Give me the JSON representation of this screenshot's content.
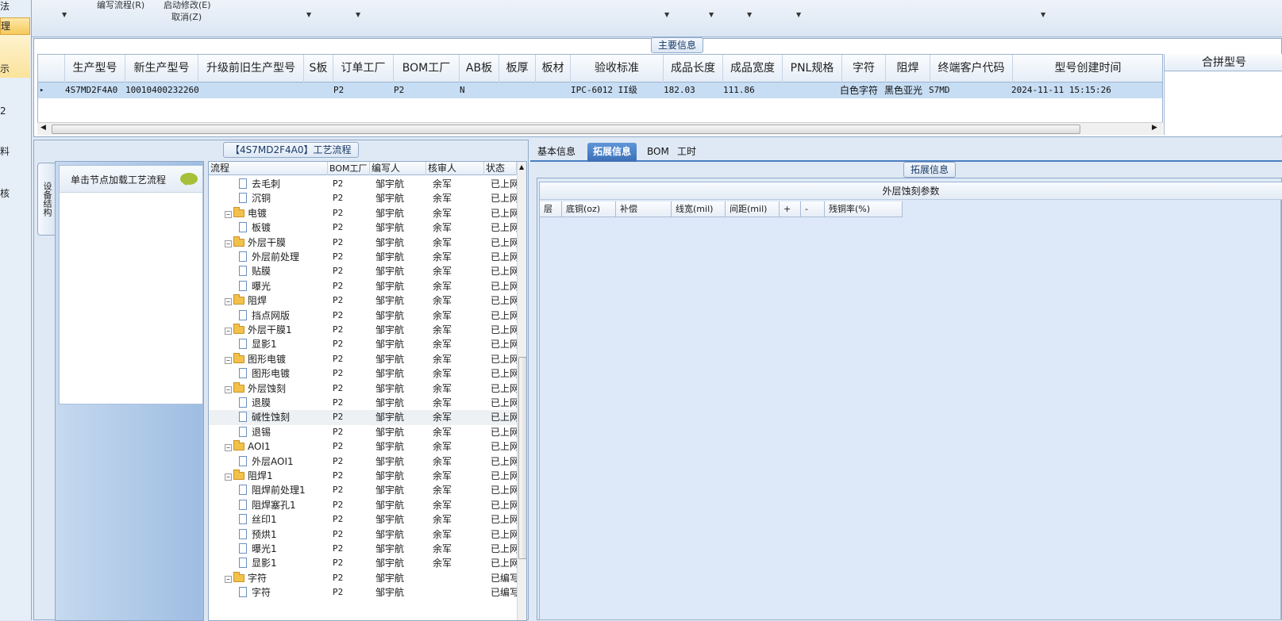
{
  "left_nav": {
    "items": [
      {
        "label": "法"
      },
      {
        "label": "理"
      },
      {
        "label": "示"
      },
      {
        "label": "2"
      },
      {
        "label": "料"
      },
      {
        "label": "核"
      }
    ]
  },
  "toolbar": {
    "edit_flow": "编写流程(R)",
    "start_modify": "启动修改(E)",
    "cancel": "取消(Z)"
  },
  "main_info": {
    "title": "主要信息",
    "columns": [
      "生产型号",
      "新生产型号",
      "升级前旧生产型号",
      "S板",
      "订单工厂",
      "BOM工厂",
      "AB板",
      "板厚",
      "板材",
      "验收标准",
      "成品长度",
      "成品宽度",
      "PNL规格",
      "字符",
      "阻焊",
      "终端客户代码",
      "型号创建时间"
    ],
    "row": {
      "indicator": "▸",
      "生产型号": "4S7MD2F4A0",
      "新生产型号": "10010400232260",
      "升级前旧生产型号": "",
      "S板": "",
      "订单工厂": "P2",
      "BOM工厂": "P2",
      "AB板": "N",
      "板厚": "",
      "板材": "",
      "验收标准": "IPC-6012 II级",
      "成品长度": "182.03",
      "成品宽度": "111.86",
      "PNL规格": "",
      "字符": "白色字符",
      "阻焊": "黑色亚光",
      "终端客户代码": "S7MD",
      "型号创建时间": "2024-11-11 15:15:26"
    },
    "right_header": "合拼型号"
  },
  "process": {
    "title": "【4S7MD2F4A0】工艺流程",
    "vertical_tab": "设备结构",
    "node_hint": "单击节点加载工艺流程",
    "columns": [
      "流程",
      "BOM工厂",
      "编写人",
      "核审人",
      "状态"
    ],
    "rows": [
      {
        "name": "去毛刺",
        "type": "doc",
        "level": 2,
        "bom": "P2",
        "writer": "邹宇航",
        "reviewer": "余军",
        "status": "已上网"
      },
      {
        "name": "沉铜",
        "type": "doc",
        "level": 2,
        "bom": "P2",
        "writer": "邹宇航",
        "reviewer": "余军",
        "status": "已上网"
      },
      {
        "name": "电镀",
        "type": "folder",
        "level": 1,
        "bom": "P2",
        "writer": "邹宇航",
        "reviewer": "余军",
        "status": "已上网"
      },
      {
        "name": "板镀",
        "type": "doc",
        "level": 2,
        "bom": "P2",
        "writer": "邹宇航",
        "reviewer": "余军",
        "status": "已上网"
      },
      {
        "name": "外层干膜",
        "type": "folder",
        "level": 1,
        "bom": "P2",
        "writer": "邹宇航",
        "reviewer": "余军",
        "status": "已上网"
      },
      {
        "name": "外层前处理",
        "type": "doc",
        "level": 2,
        "bom": "P2",
        "writer": "邹宇航",
        "reviewer": "余军",
        "status": "已上网"
      },
      {
        "name": "贴膜",
        "type": "doc",
        "level": 2,
        "bom": "P2",
        "writer": "邹宇航",
        "reviewer": "余军",
        "status": "已上网"
      },
      {
        "name": "曝光",
        "type": "doc",
        "level": 2,
        "bom": "P2",
        "writer": "邹宇航",
        "reviewer": "余军",
        "status": "已上网"
      },
      {
        "name": "阻焊",
        "type": "folder",
        "level": 1,
        "bom": "P2",
        "writer": "邹宇航",
        "reviewer": "余军",
        "status": "已上网"
      },
      {
        "name": "挡点网版",
        "type": "doc",
        "level": 2,
        "bom": "P2",
        "writer": "邹宇航",
        "reviewer": "余军",
        "status": "已上网"
      },
      {
        "name": "外层干膜1",
        "type": "folder",
        "level": 1,
        "bom": "P2",
        "writer": "邹宇航",
        "reviewer": "余军",
        "status": "已上网"
      },
      {
        "name": "显影1",
        "type": "doc",
        "level": 2,
        "bom": "P2",
        "writer": "邹宇航",
        "reviewer": "余军",
        "status": "已上网"
      },
      {
        "name": "图形电镀",
        "type": "folder",
        "level": 1,
        "bom": "P2",
        "writer": "邹宇航",
        "reviewer": "余军",
        "status": "已上网"
      },
      {
        "name": "图形电镀",
        "type": "doc",
        "level": 2,
        "bom": "P2",
        "writer": "邹宇航",
        "reviewer": "余军",
        "status": "已上网"
      },
      {
        "name": "外层蚀刻",
        "type": "folder",
        "level": 1,
        "bom": "P2",
        "writer": "邹宇航",
        "reviewer": "余军",
        "status": "已上网"
      },
      {
        "name": "退膜",
        "type": "doc",
        "level": 2,
        "bom": "P2",
        "writer": "邹宇航",
        "reviewer": "余军",
        "status": "已上网"
      },
      {
        "name": "碱性蚀刻",
        "type": "doc",
        "level": 2,
        "bom": "P2",
        "writer": "邹宇航",
        "reviewer": "余军",
        "status": "已上网",
        "selected": true
      },
      {
        "name": "退锡",
        "type": "doc",
        "level": 2,
        "bom": "P2",
        "writer": "邹宇航",
        "reviewer": "余军",
        "status": "已上网"
      },
      {
        "name": "AOI1",
        "type": "folder",
        "level": 1,
        "bom": "P2",
        "writer": "邹宇航",
        "reviewer": "余军",
        "status": "已上网"
      },
      {
        "name": "外层AOI1",
        "type": "doc",
        "level": 2,
        "bom": "P2",
        "writer": "邹宇航",
        "reviewer": "余军",
        "status": "已上网"
      },
      {
        "name": "阻焊1",
        "type": "folder",
        "level": 1,
        "bom": "P2",
        "writer": "邹宇航",
        "reviewer": "余军",
        "status": "已上网"
      },
      {
        "name": "阻焊前处理1",
        "type": "doc",
        "level": 2,
        "bom": "P2",
        "writer": "邹宇航",
        "reviewer": "余军",
        "status": "已上网"
      },
      {
        "name": "阻焊塞孔1",
        "type": "doc",
        "level": 2,
        "bom": "P2",
        "writer": "邹宇航",
        "reviewer": "余军",
        "status": "已上网"
      },
      {
        "name": "丝印1",
        "type": "doc",
        "level": 2,
        "bom": "P2",
        "writer": "邹宇航",
        "reviewer": "余军",
        "status": "已上网"
      },
      {
        "name": "预烘1",
        "type": "doc",
        "level": 2,
        "bom": "P2",
        "writer": "邹宇航",
        "reviewer": "余军",
        "status": "已上网"
      },
      {
        "name": "曝光1",
        "type": "doc",
        "level": 2,
        "bom": "P2",
        "writer": "邹宇航",
        "reviewer": "余军",
        "status": "已上网"
      },
      {
        "name": "显影1",
        "type": "doc",
        "level": 2,
        "bom": "P2",
        "writer": "邹宇航",
        "reviewer": "余军",
        "status": "已上网"
      },
      {
        "name": "字符",
        "type": "folder",
        "level": 1,
        "bom": "P2",
        "writer": "邹宇航",
        "reviewer": "",
        "status": "已编写"
      },
      {
        "name": "字符",
        "type": "doc",
        "level": 2,
        "bom": "P2",
        "writer": "邹宇航",
        "reviewer": "",
        "status": "已编写"
      }
    ]
  },
  "tabs": [
    {
      "label": "基本信息",
      "active": false
    },
    {
      "label": "拓展信息",
      "active": true
    },
    {
      "label": "BOM",
      "active": false
    },
    {
      "label": "工时",
      "active": false
    }
  ],
  "ext_info": {
    "title": "拓展信息",
    "grid_caption": "外层蚀刻参数",
    "columns": [
      "层",
      "底铜(oz)",
      "补偿",
      "线宽(mil)",
      "间距(mil)",
      "+",
      "-",
      "残铜率(%)"
    ]
  }
}
